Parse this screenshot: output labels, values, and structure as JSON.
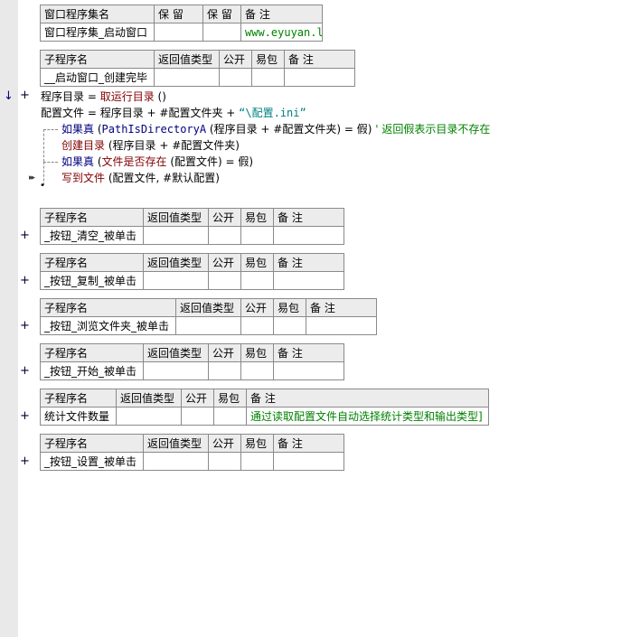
{
  "assembly_table": {
    "headers": [
      "窗口程序集名",
      "保 留",
      "保 留",
      "备 注"
    ],
    "row": [
      "窗口程序集_启动窗口",
      "",
      "",
      "www.eyuyan.la"
    ]
  },
  "sub_headers": [
    "子程序名",
    "返回值类型",
    "公开",
    "易包",
    "备 注"
  ],
  "first_sub": {
    "name": "__启动窗口_创建完毕",
    "note": ""
  },
  "code": {
    "line1": {
      "a": "程序目录",
      "b": " = ",
      "c": "取运行目录",
      "d": " ()"
    },
    "line2": {
      "a": "配置文件",
      "b": " = ",
      "c": "程序目录",
      "d": " + ",
      "e": "#配置文件夹",
      "f": " + ",
      "g": "“\\配置.ini”"
    },
    "line3": {
      "a": "如果真",
      "b": " (",
      "c": "PathIsDirectoryA",
      "d": " (程序目录 + ",
      "e": "#配置文件夹",
      "f": ") = ",
      "g": "假",
      "h": ")",
      "i": "  ' 返回假表示目录不存在"
    },
    "line4": {
      "a": "创建目录",
      "b": " (程序目录 + ",
      "c": "#配置文件夹",
      "d": ")"
    },
    "line5": {
      "a": "如果真",
      "b": " (",
      "c": "文件是否存在",
      "d": " (配置文件) = ",
      "e": "假",
      "f": ")"
    },
    "line6": {
      "a": "写到文件",
      "b": " (配置文件, ",
      "c": "#默认配置",
      "d": ")"
    }
  },
  "subs": [
    {
      "name": "_按钮_清空_被单击",
      "note": ""
    },
    {
      "name": "_按钮_复制_被单击",
      "note": ""
    },
    {
      "name": "_按钮_浏览文件夹_被单击",
      "note": ""
    },
    {
      "name": "_按钮_开始_被单击",
      "note": ""
    },
    {
      "name": "统计文件数量",
      "note": "通过读取配置文件自动选择统计类型和输出类型]"
    },
    {
      "name": "_按钮_设置_被单击",
      "note": ""
    }
  ],
  "glyphs": {
    "plus": "+",
    "arrow": "↓",
    "fast_forward": "▸▸",
    "dot": "•"
  }
}
